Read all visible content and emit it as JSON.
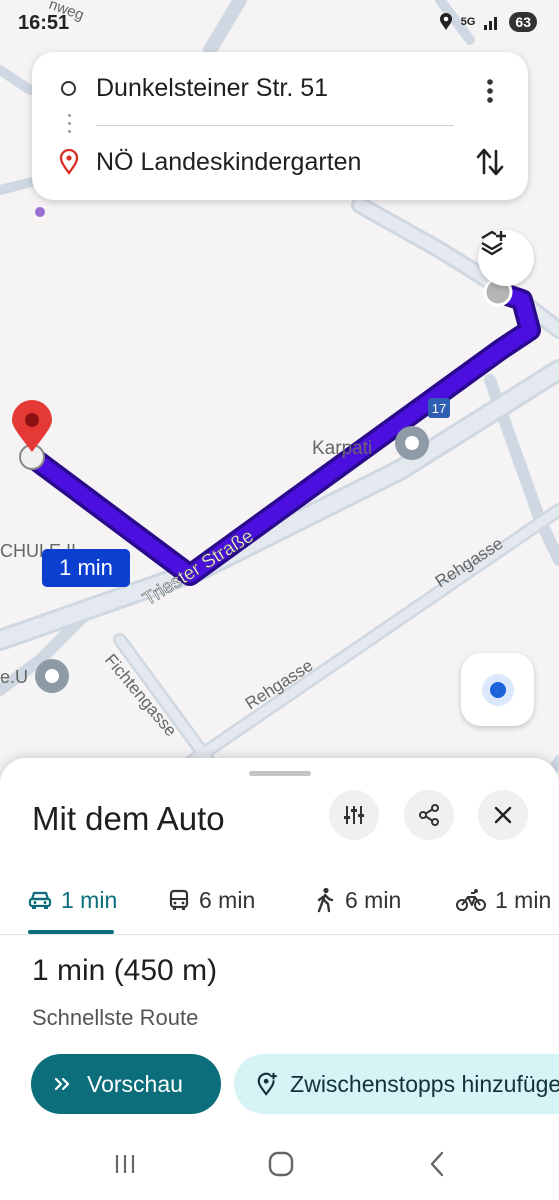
{
  "status_bar": {
    "time": "16:51",
    "network": "5G",
    "battery": "63",
    "icons": [
      "location-icon",
      "signal-icon",
      "battery-icon"
    ]
  },
  "map": {
    "street_labels": [
      "Triester Straße",
      "Rehgasse",
      "Rehgasse",
      "Fichtengasse",
      "nweg"
    ],
    "poi_label": "Karpati",
    "school_label": "CHULE II",
    "eu_label": "e.U",
    "road_badge": "17",
    "eta_badge": "1 min",
    "route_color": "#4b0fe0",
    "route_outline_color": "#2a0a8c"
  },
  "route_card": {
    "origin": "Dunkelsteiner Str. 51",
    "destination": "NÖ Landeskindergarten"
  },
  "sheet": {
    "title": "Mit dem Auto",
    "tabs": [
      {
        "mode": "car",
        "label": "1 min",
        "icon": "car-icon",
        "active": true
      },
      {
        "mode": "transit",
        "label": "6 min",
        "icon": "bus-icon",
        "active": false
      },
      {
        "mode": "walk",
        "label": "6 min",
        "icon": "walk-icon",
        "active": false
      },
      {
        "mode": "bike",
        "label": "1 min",
        "icon": "bike-icon",
        "active": false
      }
    ],
    "route_summary": "1 min (450 m)",
    "route_subtitle": "Schnellste Route",
    "preview_label": "Vorschau",
    "add_stops_label": "Zwischenstopps hinzufügen",
    "accent_color": "#0b6e7a"
  }
}
